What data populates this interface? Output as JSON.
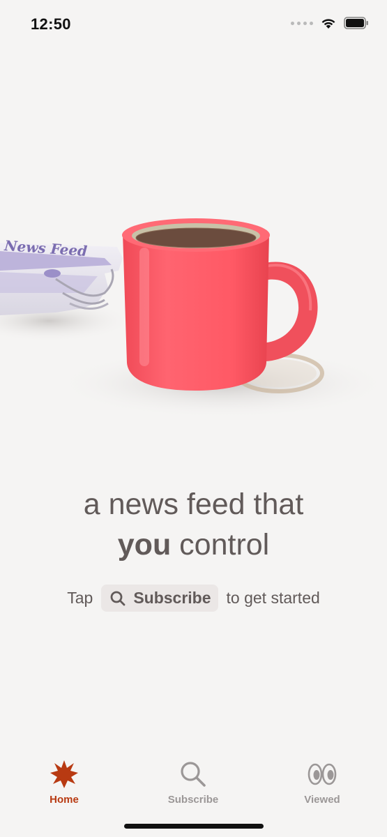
{
  "status_bar": {
    "time": "12:50"
  },
  "hero": {
    "newspaper_masthead": "News Feed"
  },
  "headline": {
    "line1": "a news feed that",
    "bold_word": "you",
    "line2_rest": " control"
  },
  "hint": {
    "prefix": "Tap",
    "chip_label": "Subscribe",
    "suffix": "to get started"
  },
  "tab_bar": {
    "tabs": [
      {
        "label": "Home",
        "icon": "home-star-icon",
        "active": true
      },
      {
        "label": "Subscribe",
        "icon": "search-icon",
        "active": false
      },
      {
        "label": "Viewed",
        "icon": "eyes-icon",
        "active": false
      }
    ]
  },
  "colors": {
    "background": "#f5f4f3",
    "text": "#615a59",
    "active_tab": "#b83a12",
    "inactive_tab": "#9b9797",
    "mug": "#ff5a66"
  }
}
